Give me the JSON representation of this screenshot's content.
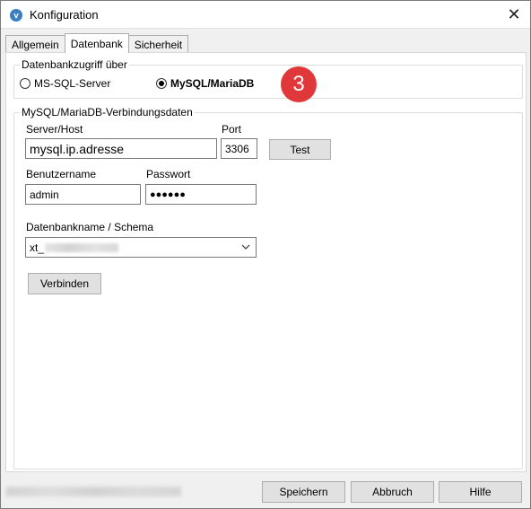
{
  "window": {
    "title": "Konfiguration",
    "close_glyph": "✕",
    "app_icon": "settings-app-icon",
    "app_icon_glyph": "ⅴ"
  },
  "tabs": [
    {
      "label": "Allgemein"
    },
    {
      "label": "Datenbank",
      "active": true
    },
    {
      "label": "Sicherheit"
    }
  ],
  "db_access": {
    "legend": "Datenbankzugriff über",
    "option_mssql": "MS-SQL-Server",
    "option_mysql": "MySQL/MariaDB",
    "selected": "MySQL/MariaDB"
  },
  "step_badge": {
    "number": "3",
    "color": "#e0383a"
  },
  "mysql_group": {
    "legend": "MySQL/MariaDB-Verbindungsdaten",
    "server_label": "Server/Host",
    "server_value": "mysql.ip.adresse",
    "port_label": "Port",
    "port_value": "3306",
    "test_button": "Test",
    "user_label": "Benutzername",
    "user_value": "admin",
    "password_label": "Passwort",
    "password_value": "●●●●●●",
    "dbname_label": "Datenbankname / Schema",
    "dbname_value": "xt_",
    "connect_button": "Verbinden"
  },
  "footer": {
    "save_button": "Speichern",
    "cancel_button": "Abbruch",
    "help_button": "Hilfe"
  }
}
